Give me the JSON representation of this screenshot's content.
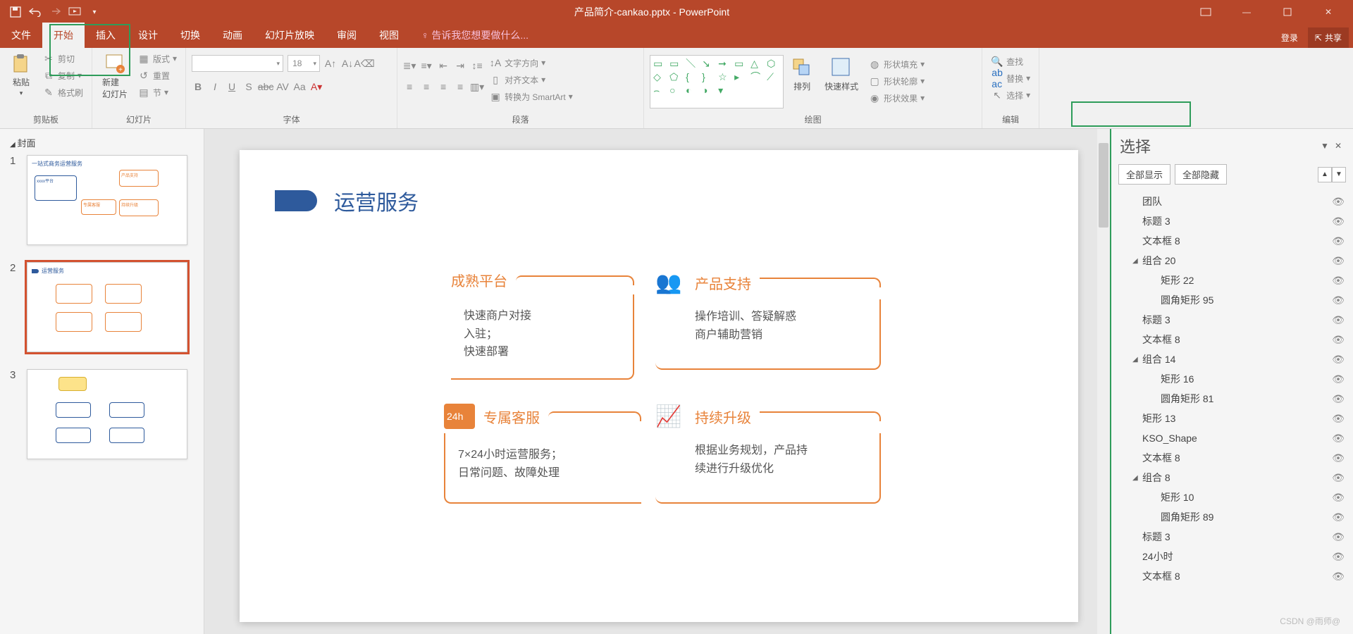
{
  "app": {
    "title_doc": "产品简介-cankao.pptx",
    "title_app": "PowerPoint"
  },
  "qat": {
    "save": "保存",
    "undo": "撤销",
    "redo": "重做",
    "start": "从头开始"
  },
  "window": {
    "login": "登录",
    "share": "共享"
  },
  "tabs": [
    "文件",
    "开始",
    "插入",
    "设计",
    "切换",
    "动画",
    "幻灯片放映",
    "审阅",
    "视图"
  ],
  "tell_me": "告诉我您想要做什么...",
  "ribbon": {
    "clipboard": {
      "paste": "粘贴",
      "cut": "剪切",
      "copy": "复制",
      "format_painter": "格式刷",
      "label": "剪贴板"
    },
    "slides": {
      "new_slide": "新建\n幻灯片",
      "layout": "版式",
      "reset": "重置",
      "section": "节",
      "label": "幻灯片"
    },
    "font": {
      "name_ph": "",
      "size": "18",
      "label": "字体"
    },
    "paragraph": {
      "text_dir": "文字方向",
      "align_text": "对齐文本",
      "smartart": "转换为 SmartArt",
      "label": "段落"
    },
    "drawing": {
      "arrange": "排列",
      "quick_style": "快速样式",
      "shape_fill": "形状填充",
      "shape_outline": "形状轮廓",
      "shape_effects": "形状效果",
      "label": "绘图"
    },
    "editing": {
      "find": "查找",
      "replace": "替换",
      "select": "选择",
      "label": "编辑"
    }
  },
  "thumbs": {
    "section": "封面",
    "nums": [
      "1",
      "2",
      "3"
    ],
    "t1_title": "一站式商务运营服务",
    "t2_title": "运营服务"
  },
  "slide": {
    "title": "运营服务",
    "cards": [
      {
        "h": "成熟平台",
        "b": "快速商户对接\n入驻；\n快速部署"
      },
      {
        "h": "产品支持",
        "b": "操作培训、答疑解惑\n商户辅助营销"
      },
      {
        "h": "专属客服",
        "b": "7×24小时运营服务；\n日常问题、故障处理",
        "badge": "24h"
      },
      {
        "h": "持续升级",
        "b": "根据业务规划，产品持\n续进行升级优化"
      }
    ]
  },
  "selection": {
    "title": "选择",
    "show_all": "全部显示",
    "hide_all": "全部隐藏",
    "items": [
      {
        "t": "团队",
        "d": 1
      },
      {
        "t": "标题 3",
        "d": 1
      },
      {
        "t": "文本框 8",
        "d": 1
      },
      {
        "t": "组合 20",
        "d": 1,
        "g": true
      },
      {
        "t": "矩形 22",
        "d": 2
      },
      {
        "t": "圆角矩形 95",
        "d": 2
      },
      {
        "t": "标题 3",
        "d": 1
      },
      {
        "t": "文本框 8",
        "d": 1
      },
      {
        "t": "组合 14",
        "d": 1,
        "g": true
      },
      {
        "t": "矩形 16",
        "d": 2
      },
      {
        "t": "圆角矩形 81",
        "d": 2
      },
      {
        "t": "矩形 13",
        "d": 1
      },
      {
        "t": "KSO_Shape",
        "d": 1
      },
      {
        "t": "文本框 8",
        "d": 1
      },
      {
        "t": "组合 8",
        "d": 1,
        "g": true
      },
      {
        "t": "矩形 10",
        "d": 2
      },
      {
        "t": "圆角矩形 89",
        "d": 2
      },
      {
        "t": "标题 3",
        "d": 1
      },
      {
        "t": "24小时",
        "d": 1
      },
      {
        "t": "文本框 8",
        "d": 1
      }
    ]
  },
  "watermark": "CSDN @雨师@"
}
